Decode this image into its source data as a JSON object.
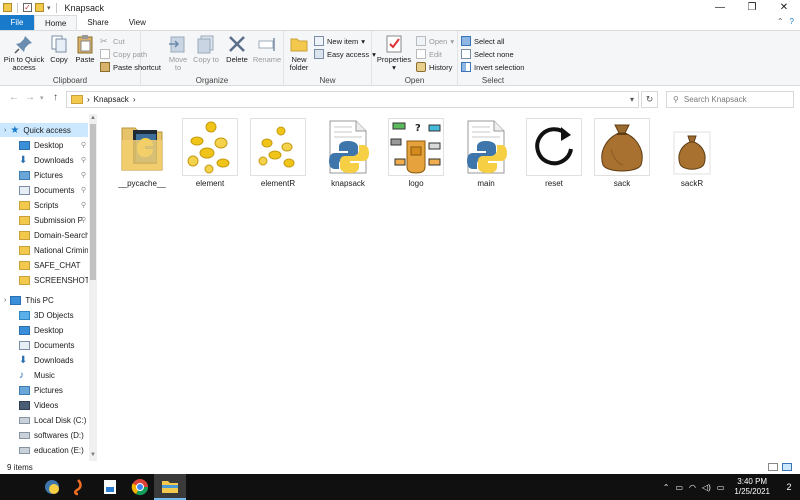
{
  "window": {
    "title": "Knapsack",
    "controls": {
      "minimize": "—",
      "maximize": "❐",
      "close": "✕"
    }
  },
  "ribbon_tabs": [
    "File",
    "Home",
    "Share",
    "View"
  ],
  "ribbon": {
    "clipboard": {
      "label": "Clipboard",
      "pin_to_quick_access": "Pin to Quick access",
      "copy": "Copy",
      "paste": "Paste",
      "cut": "Cut",
      "copy_path": "Copy path",
      "paste_shortcut": "Paste shortcut"
    },
    "organize": {
      "label": "Organize",
      "move_to": "Move to",
      "copy_to": "Copy to",
      "delete": "Delete",
      "rename": "Rename"
    },
    "new": {
      "label": "New",
      "new_folder": "New folder",
      "new_item": "New item",
      "easy_access": "Easy access"
    },
    "open": {
      "label": "Open",
      "properties": "Properties",
      "open": "Open",
      "edit": "Edit",
      "history": "History"
    },
    "select": {
      "label": "Select",
      "select_all": "Select all",
      "select_none": "Select none",
      "invert_selection": "Invert selection"
    }
  },
  "address": {
    "path": "Knapsack",
    "separator": "›",
    "search_placeholder": "Search Knapsack"
  },
  "nav_pane": {
    "quick_access": "Quick access",
    "quick_items": [
      "Desktop",
      "Downloads",
      "Pictures",
      "Documents",
      "Scripts",
      "Submission P",
      "Domain-Search-",
      "National Crimina",
      "SAFE_CHAT",
      "SCREENSHOTS"
    ],
    "this_pc": "This PC",
    "pc_items": [
      "3D Objects",
      "Desktop",
      "Documents",
      "Downloads",
      "Music",
      "Pictures",
      "Videos",
      "Local Disk (C:)",
      "softwares (D:)",
      "education (E:)"
    ]
  },
  "files": [
    {
      "name": "__pycache__",
      "type": "folder"
    },
    {
      "name": "element",
      "type": "coins"
    },
    {
      "name": "elementR",
      "type": "coins"
    },
    {
      "name": "knapsack",
      "type": "python"
    },
    {
      "name": "logo",
      "type": "logo"
    },
    {
      "name": "main",
      "type": "python"
    },
    {
      "name": "reset",
      "type": "reset"
    },
    {
      "name": "sack",
      "type": "sack"
    },
    {
      "name": "sackR",
      "type": "sack-small"
    }
  ],
  "status": {
    "item_count": "9 items"
  },
  "taskbar": {
    "time": "3:40 PM",
    "date": "1/25/2021",
    "notifications": "2"
  }
}
